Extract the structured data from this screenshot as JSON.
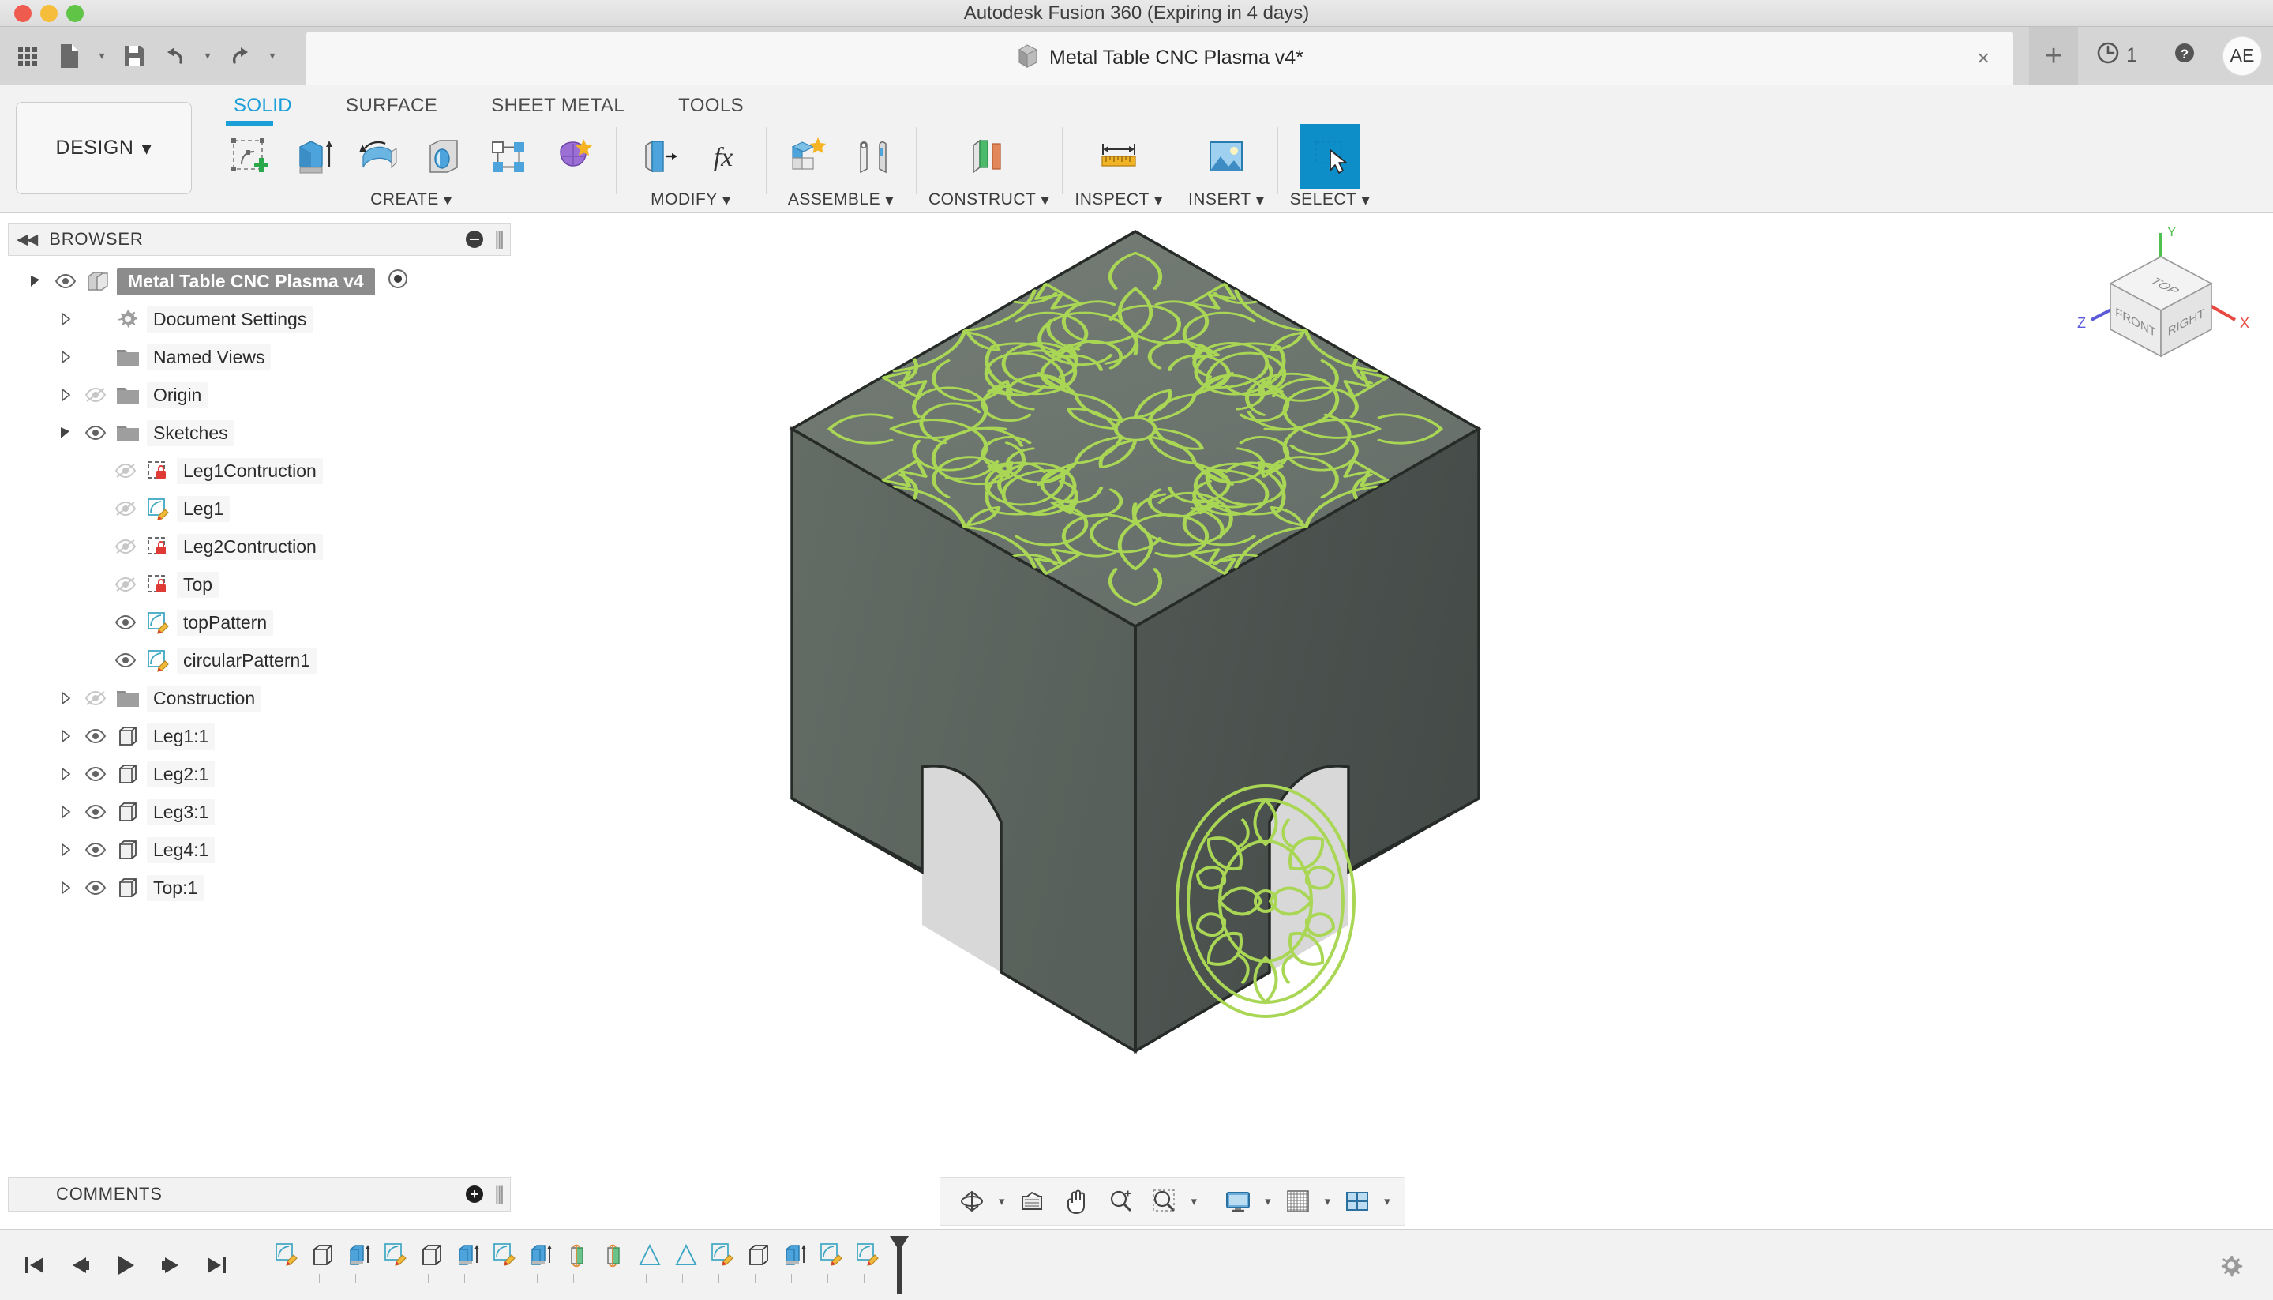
{
  "window": {
    "mac_title": "Autodesk Fusion 360 (Expiring in 4 days)",
    "traffic_lights": [
      "close-red",
      "minimize-yellow",
      "maximize-green"
    ]
  },
  "quick_access": {
    "grid_icon": "app-grid-icon",
    "new_icon": "new-document-icon",
    "save_icon": "save-icon",
    "undo_icon": "undo-icon",
    "redo_icon": "redo-icon"
  },
  "document_tab": {
    "label": "Metal Table CNC Plasma v4*",
    "doc_icon": "cube-document-icon",
    "close_label": "×",
    "new_tab_label": "+"
  },
  "top_right": {
    "job_status_count": "1",
    "job_status_icon": "clock-icon",
    "help_icon": "help-question-icon",
    "avatar_initials": "AE"
  },
  "ribbon": {
    "workspace_label": "DESIGN",
    "workspace_caret": "▾",
    "tabs": [
      {
        "label": "SOLID",
        "active": true
      },
      {
        "label": "SURFACE",
        "active": false
      },
      {
        "label": "SHEET METAL",
        "active": false
      },
      {
        "label": "TOOLS",
        "active": false
      }
    ],
    "groups": [
      {
        "label": "CREATE",
        "caret": "▾",
        "tools": [
          {
            "name": "create-sketch-icon",
            "selected": false
          },
          {
            "name": "extrude-icon",
            "selected": false
          },
          {
            "name": "revolve-icon",
            "selected": false
          },
          {
            "name": "hole-icon",
            "selected": false
          },
          {
            "name": "rectangular-pattern-icon",
            "selected": false
          },
          {
            "name": "form-icon",
            "selected": false
          }
        ]
      },
      {
        "label": "MODIFY",
        "caret": "▾",
        "tools": [
          {
            "name": "press-pull-icon",
            "selected": false
          },
          {
            "name": "change-parameters-icon",
            "selected": false
          }
        ]
      },
      {
        "label": "ASSEMBLE",
        "caret": "▾",
        "tools": [
          {
            "name": "new-component-icon",
            "selected": false
          },
          {
            "name": "joint-icon",
            "selected": false
          }
        ]
      },
      {
        "label": "CONSTRUCT",
        "caret": "▾",
        "tools": [
          {
            "name": "offset-plane-icon",
            "selected": false
          }
        ]
      },
      {
        "label": "INSPECT",
        "caret": "▾",
        "tools": [
          {
            "name": "measure-icon",
            "selected": false
          }
        ]
      },
      {
        "label": "INSERT",
        "caret": "▾",
        "tools": [
          {
            "name": "insert-image-icon",
            "selected": false
          }
        ]
      },
      {
        "label": "SELECT",
        "caret": "▾",
        "tools": [
          {
            "name": "select-cursor-icon",
            "selected": true
          }
        ]
      }
    ]
  },
  "browser": {
    "title": "BROWSER",
    "collapse_icon": "collapse-left-icon",
    "minimize_icon": "minus-circle-icon",
    "grip_icon": "panel-grip-icon",
    "tree": [
      {
        "label": "Metal Table CNC Plasma v4",
        "indent": 0,
        "expander": "open",
        "eye": "visible",
        "icon": "component-icon",
        "root": true
      },
      {
        "label": "Document Settings",
        "indent": 1,
        "expander": "closed",
        "eye": "none",
        "icon": "gear-icon",
        "root": false
      },
      {
        "label": "Named Views",
        "indent": 1,
        "expander": "closed",
        "eye": "none",
        "icon": "folder-icon",
        "root": false
      },
      {
        "label": "Origin",
        "indent": 1,
        "expander": "closed",
        "eye": "hidden",
        "icon": "folder-icon",
        "root": false
      },
      {
        "label": "Sketches",
        "indent": 1,
        "expander": "open",
        "eye": "visible",
        "icon": "folder-icon",
        "root": false
      },
      {
        "label": "Leg1Contruction",
        "indent": 2,
        "expander": "none",
        "eye": "hidden",
        "icon": "sketch-locked-icon",
        "root": false
      },
      {
        "label": "Leg1",
        "indent": 2,
        "expander": "none",
        "eye": "hidden",
        "icon": "sketch-icon",
        "root": false
      },
      {
        "label": "Leg2Contruction",
        "indent": 2,
        "expander": "none",
        "eye": "hidden",
        "icon": "sketch-locked-icon",
        "root": false
      },
      {
        "label": "Top",
        "indent": 2,
        "expander": "none",
        "eye": "hidden",
        "icon": "sketch-locked-icon",
        "root": false
      },
      {
        "label": "topPattern",
        "indent": 2,
        "expander": "none",
        "eye": "visible",
        "icon": "sketch-icon",
        "root": false
      },
      {
        "label": "circularPattern1",
        "indent": 2,
        "expander": "none",
        "eye": "visible",
        "icon": "sketch-icon",
        "root": false
      },
      {
        "label": "Construction",
        "indent": 1,
        "expander": "closed",
        "eye": "hidden",
        "icon": "folder-icon",
        "root": false
      },
      {
        "label": "Leg1:1",
        "indent": 1,
        "expander": "closed",
        "eye": "visible",
        "icon": "body-icon",
        "root": false
      },
      {
        "label": "Leg2:1",
        "indent": 1,
        "expander": "closed",
        "eye": "visible",
        "icon": "body-icon",
        "root": false
      },
      {
        "label": "Leg3:1",
        "indent": 1,
        "expander": "closed",
        "eye": "visible",
        "icon": "body-icon",
        "root": false
      },
      {
        "label": "Leg4:1",
        "indent": 1,
        "expander": "closed",
        "eye": "visible",
        "icon": "body-icon",
        "root": false
      },
      {
        "label": "Top:1",
        "indent": 1,
        "expander": "closed",
        "eye": "visible",
        "icon": "body-icon",
        "root": false
      }
    ]
  },
  "comments": {
    "title": "COMMENTS",
    "add_label": "+",
    "grip_icon": "panel-grip-icon"
  },
  "viewport": {
    "model_name": "metal-table-cnc-plasma",
    "colors": {
      "top_face": "#6e7670",
      "left_face": "#5f6760",
      "right_face": "#4d5450",
      "pattern_stroke": "#a9d755",
      "edge": "#2a2f2c",
      "floor_shadow": "#d9d9d9"
    },
    "viewcube": {
      "faces": {
        "top": "TOP",
        "front": "FRONT",
        "right": "RIGHT"
      },
      "axes": {
        "x": "X",
        "y": "Y",
        "z": "Z"
      },
      "axis_colors": {
        "x": "#e8483f",
        "y": "#4fc04f",
        "z": "#5a5ad8"
      }
    }
  },
  "view_toolbar": {
    "buttons": [
      {
        "name": "orbit-icon",
        "caret": true
      },
      {
        "name": "look-at-icon",
        "caret": false
      },
      {
        "name": "pan-icon",
        "caret": false
      },
      {
        "name": "zoom-in-icon",
        "caret": false
      },
      {
        "name": "zoom-window-icon",
        "caret": true
      },
      {
        "name": "display-settings-icon",
        "caret": true
      },
      {
        "name": "grid-snaps-icon",
        "caret": true
      },
      {
        "name": "viewports-icon",
        "caret": true
      }
    ],
    "caret": "▾"
  },
  "timeline": {
    "playback": [
      {
        "name": "go-to-beginning-button"
      },
      {
        "name": "step-backward-button"
      },
      {
        "name": "play-button"
      },
      {
        "name": "step-forward-button"
      },
      {
        "name": "go-to-end-button"
      }
    ],
    "features": [
      {
        "name": "sketch-feature",
        "type": "sketch"
      },
      {
        "name": "extrude-gray-feature",
        "type": "extrude-gray"
      },
      {
        "name": "extrude-blue-feature",
        "type": "extrude-blue"
      },
      {
        "name": "sketch-feature",
        "type": "sketch"
      },
      {
        "name": "extrude-gray-feature",
        "type": "extrude-gray"
      },
      {
        "name": "extrude-blue-feature",
        "type": "extrude-blue"
      },
      {
        "name": "sketch-feature",
        "type": "sketch"
      },
      {
        "name": "extrude-blue-feature",
        "type": "extrude-blue"
      },
      {
        "name": "revolve-feature",
        "type": "revolve"
      },
      {
        "name": "revolve-feature",
        "type": "revolve"
      },
      {
        "name": "loft-feature",
        "type": "loft"
      },
      {
        "name": "loft-feature",
        "type": "loft"
      },
      {
        "name": "sketch-feature",
        "type": "sketch"
      },
      {
        "name": "extrude-gray-feature",
        "type": "extrude-gray"
      },
      {
        "name": "extrude-blue-feature",
        "type": "extrude-blue"
      },
      {
        "name": "sketch-feature",
        "type": "sketch"
      },
      {
        "name": "sketch-feature",
        "type": "sketch"
      }
    ],
    "marker_name": "timeline-end-marker",
    "settings_icon": "gear-icon"
  }
}
